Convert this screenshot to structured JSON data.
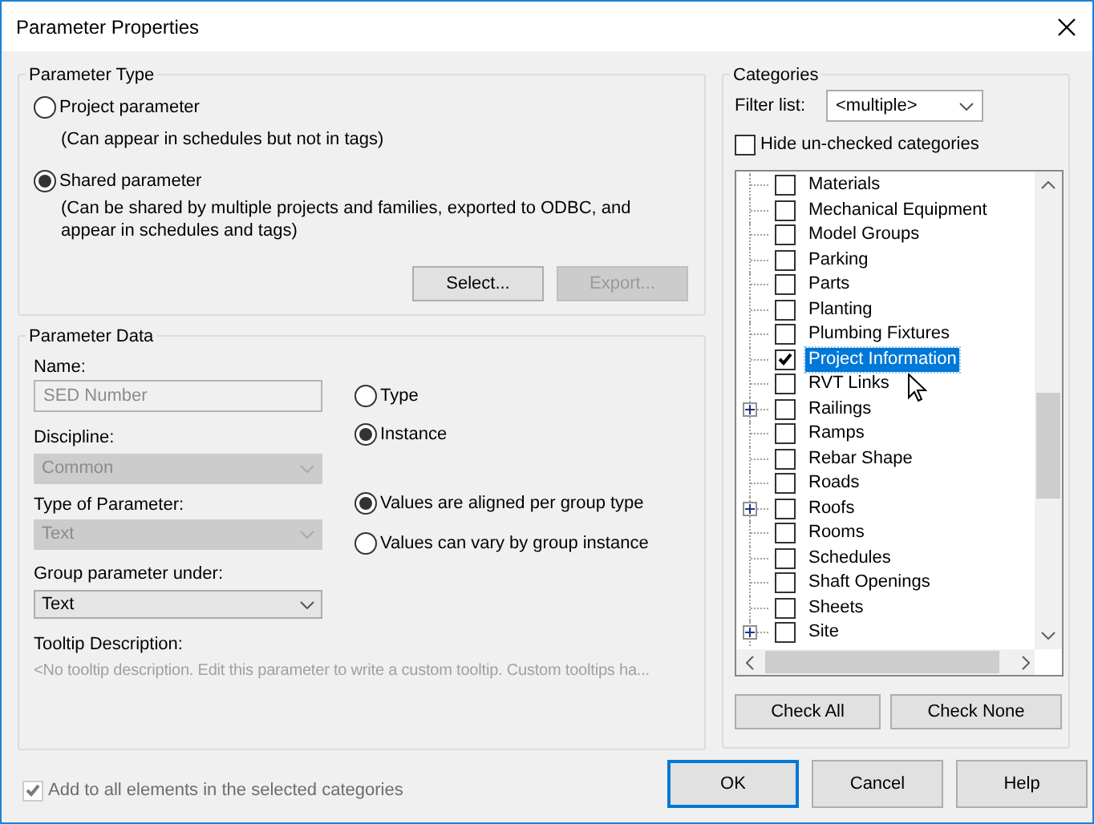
{
  "window": {
    "title": "Parameter Properties"
  },
  "parameter_type": {
    "title": "Parameter Type",
    "options": [
      {
        "label": "Project parameter",
        "selected": false,
        "note": "(Can appear in schedules but not in tags)"
      },
      {
        "label": "Shared parameter",
        "selected": true,
        "note": "(Can be shared by multiple projects and families, exported to ODBC, and appear in schedules and tags)"
      }
    ],
    "buttons": [
      {
        "label": "Select...",
        "disabled": false
      },
      {
        "label": "Export...",
        "disabled": true
      }
    ]
  },
  "parameter_data": {
    "title": "Parameter Data",
    "fields": [
      {
        "kind": "text",
        "label": "Name:",
        "value": "SED Number",
        "disabled": true
      },
      {
        "kind": "dropdown",
        "label": "Discipline:",
        "value": "Common",
        "disabled": true
      },
      {
        "kind": "dropdown",
        "label": "Type of Parameter:",
        "value": "Text",
        "disabled": true
      },
      {
        "kind": "dropdown",
        "label": "Group parameter under:",
        "value": "Text",
        "disabled": false
      }
    ],
    "scope_options": [
      {
        "label": "Type",
        "selected": false
      },
      {
        "label": "Instance",
        "selected": true
      }
    ],
    "group_options": [
      {
        "label": "Values are aligned per group type",
        "selected": true
      },
      {
        "label": "Values can vary by group instance",
        "selected": false
      }
    ],
    "tooltip": {
      "label": "Tooltip Description:",
      "text": "<No tooltip description. Edit this parameter to write a custom tooltip. Custom tooltips ha..."
    }
  },
  "categories": {
    "title": "Categories",
    "filter_label": "Filter list:",
    "filter_value": "<multiple>",
    "hide_unchecked": {
      "label": "Hide un-checked categories",
      "checked": false
    },
    "items": [
      {
        "label": "Materials",
        "checked": false,
        "selected": false,
        "expandable": false
      },
      {
        "label": "Mechanical Equipment",
        "checked": false,
        "selected": false,
        "expandable": false
      },
      {
        "label": "Model Groups",
        "checked": false,
        "selected": false,
        "expandable": false
      },
      {
        "label": "Parking",
        "checked": false,
        "selected": false,
        "expandable": false
      },
      {
        "label": "Parts",
        "checked": false,
        "selected": false,
        "expandable": false
      },
      {
        "label": "Planting",
        "checked": false,
        "selected": false,
        "expandable": false
      },
      {
        "label": "Plumbing Fixtures",
        "checked": false,
        "selected": false,
        "expandable": false
      },
      {
        "label": "Project Information",
        "checked": true,
        "selected": true,
        "expandable": false
      },
      {
        "label": "RVT Links",
        "checked": false,
        "selected": false,
        "expandable": false
      },
      {
        "label": "Railings",
        "checked": false,
        "selected": false,
        "expandable": true
      },
      {
        "label": "Ramps",
        "checked": false,
        "selected": false,
        "expandable": false
      },
      {
        "label": "Rebar Shape",
        "checked": false,
        "selected": false,
        "expandable": false
      },
      {
        "label": "Roads",
        "checked": false,
        "selected": false,
        "expandable": false
      },
      {
        "label": "Roofs",
        "checked": false,
        "selected": false,
        "expandable": true
      },
      {
        "label": "Rooms",
        "checked": false,
        "selected": false,
        "expandable": false
      },
      {
        "label": "Schedules",
        "checked": false,
        "selected": false,
        "expandable": false
      },
      {
        "label": "Shaft Openings",
        "checked": false,
        "selected": false,
        "expandable": false
      },
      {
        "label": "Sheets",
        "checked": false,
        "selected": false,
        "expandable": false
      },
      {
        "label": "Site",
        "checked": false,
        "selected": false,
        "expandable": true
      }
    ],
    "buttons": [
      {
        "label": "Check All"
      },
      {
        "label": "Check None"
      }
    ]
  },
  "add_to_all": {
    "label": "Add to all elements in the selected categories",
    "checked": true,
    "disabled": true
  },
  "buttons": [
    {
      "label": "OK",
      "default": true
    },
    {
      "label": "Cancel",
      "default": false
    },
    {
      "label": "Help",
      "default": false
    }
  ]
}
